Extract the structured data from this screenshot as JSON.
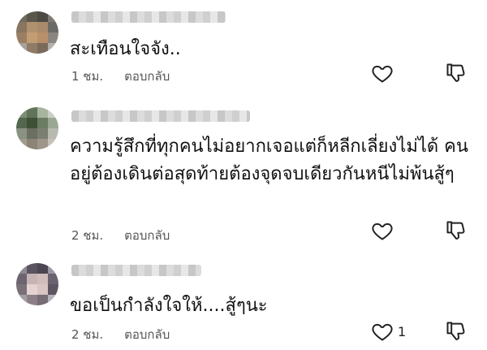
{
  "comments": [
    {
      "text": "สะเทือนใจจัง..",
      "time": "1 ชม.",
      "reply_label": "ตอบกลับ",
      "like_count": ""
    },
    {
      "text": "ความรู้สึกที่ทุกคนไม่อยากเจอแต่ก็หลีกเลี่ยงไม่ได้ คนอยู่ต้องเดินต่อสุดท้ายต้องจุดจบเดียวกันหนีไม่พ้นสู้ๆ",
      "time": "2 ชม.",
      "reply_label": "ตอบกลับ",
      "like_count": ""
    },
    {
      "text": "ขอเป็นกำลังใจให้....สู้ๆนะ",
      "time": "2 ชม.",
      "reply_label": "ตอบกลับ",
      "like_count": "1"
    }
  ],
  "icons": {
    "like": "heart-outline-icon",
    "dislike": "thumbs-down-outline-icon"
  },
  "colors": {
    "text": "#111111",
    "meta": "#555555",
    "icon": "#222222"
  }
}
